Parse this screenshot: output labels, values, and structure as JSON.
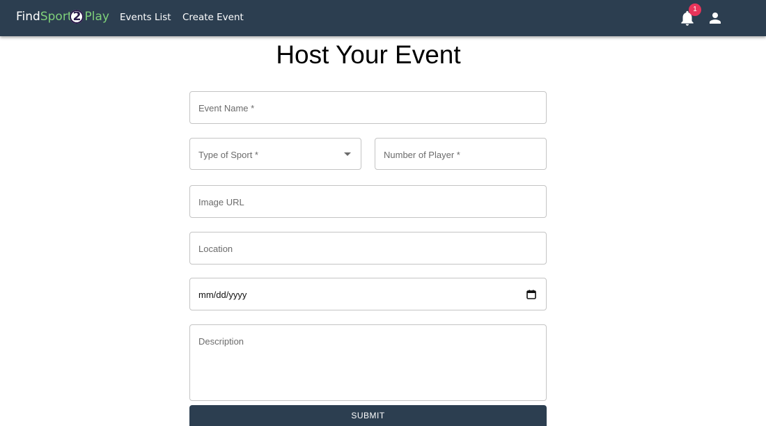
{
  "navbar": {
    "brand": {
      "find": "Find",
      "sport": "Sport",
      "two": "2",
      "play": "Play"
    },
    "links": {
      "events_list": "Events List",
      "create_event": "Create Event"
    },
    "notifications": {
      "icon": "bell-icon",
      "count": "1"
    },
    "account_icon": "person-icon",
    "colors": {
      "background": "#2c3e50",
      "brand_accent": "#7fd17a",
      "badge": "#e8345a"
    }
  },
  "form": {
    "title": "Host Your Event",
    "event_name_placeholder": "Event Name *",
    "sport_type_placeholder": "Type of Sport *",
    "players_placeholder": "Number of Player *",
    "image_url_placeholder": "Image URL",
    "location_placeholder": "Location",
    "date_value": "mm/dd/yyyy",
    "description_placeholder": "Description",
    "submit_label": "SUBMIT"
  }
}
